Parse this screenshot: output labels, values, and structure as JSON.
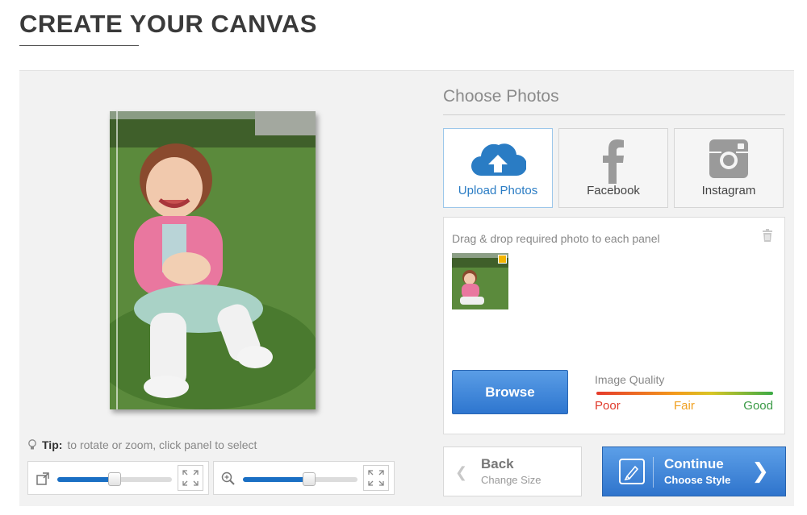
{
  "page": {
    "title": "CREATE YOUR CANVAS"
  },
  "tip": {
    "label": "Tip:",
    "text": "to rotate or zoom, click panel to select"
  },
  "controls": {
    "rotate": {
      "icon": "rotate-icon",
      "level": 0.5
    },
    "zoom": {
      "icon": "zoom-in-icon",
      "level": 0.58
    }
  },
  "photos": {
    "title": "Choose Photos",
    "sources": [
      {
        "label": "Upload Photos",
        "icon": "cloud-upload-icon",
        "active": true
      },
      {
        "label": "Facebook",
        "icon": "facebook-icon",
        "active": false
      },
      {
        "label": "Instagram",
        "icon": "instagram-icon",
        "active": false
      }
    ],
    "drop_text": "Drag & drop required photo to each panel",
    "browse_label": "Browse",
    "quality": {
      "label": "Image Quality",
      "poor": "Poor",
      "fair": "Fair",
      "good": "Good"
    }
  },
  "nav": {
    "back": {
      "label": "Back",
      "sub": "Change Size"
    },
    "continue": {
      "label": "Continue",
      "sub": "Choose Style"
    }
  },
  "colors": {
    "accent": "#2f74cc",
    "active_blue": "#2a7cc4",
    "badge": "#f2b400"
  }
}
